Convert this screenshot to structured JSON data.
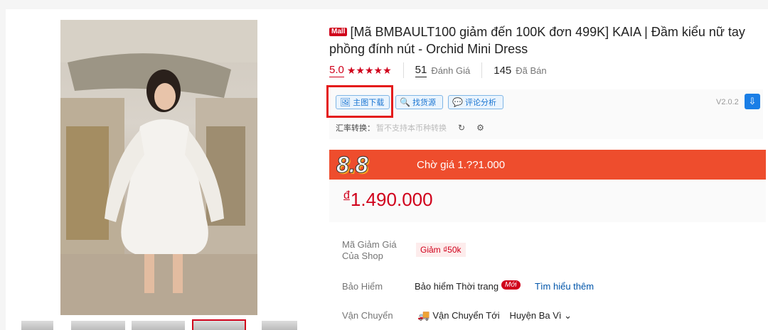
{
  "product": {
    "mall_badge": "Mall",
    "title": "[Mã BMBAULT100 giảm đến 100K đơn 499K] KAIA | Đầm kiểu nữ tay phồng đính nút - Orchid Mini Dress",
    "rating": "5.0",
    "stars": "★★★★★",
    "reviews_count": "51",
    "reviews_label": "Đánh Giá",
    "sold_count": "145",
    "sold_label": "Đã Bán"
  },
  "plugin": {
    "btn_download": "主图下载",
    "btn_source": "找货源",
    "btn_analysis": "评论分析",
    "version": "V2.0.2",
    "fx_label": "汇率转换：",
    "fx_value": "暂不支持本币种转换"
  },
  "flash_sale": {
    "logo": "8.8",
    "text": "Chờ giá 1.??1.000"
  },
  "price": {
    "currency": "đ",
    "amount": "1.490.000"
  },
  "details": {
    "voucher_label": "Mã Giảm Giá Của Shop",
    "voucher_value": "Giảm ₫50k",
    "insurance_label": "Bảo Hiểm",
    "insurance_value": "Bảo hiểm Thời trang",
    "insurance_badge": "Mới",
    "insurance_link": "Tìm hiểu thêm",
    "shipping_label": "Vận Chuyển",
    "shipping_to_label": "Vận Chuyển Tới",
    "shipping_to_value": "Huyện Ba Vì"
  },
  "colors": {
    "brand_red": "#d0011b",
    "flash_orange": "#ee4d2d",
    "plugin_blue": "#1a75d2"
  }
}
